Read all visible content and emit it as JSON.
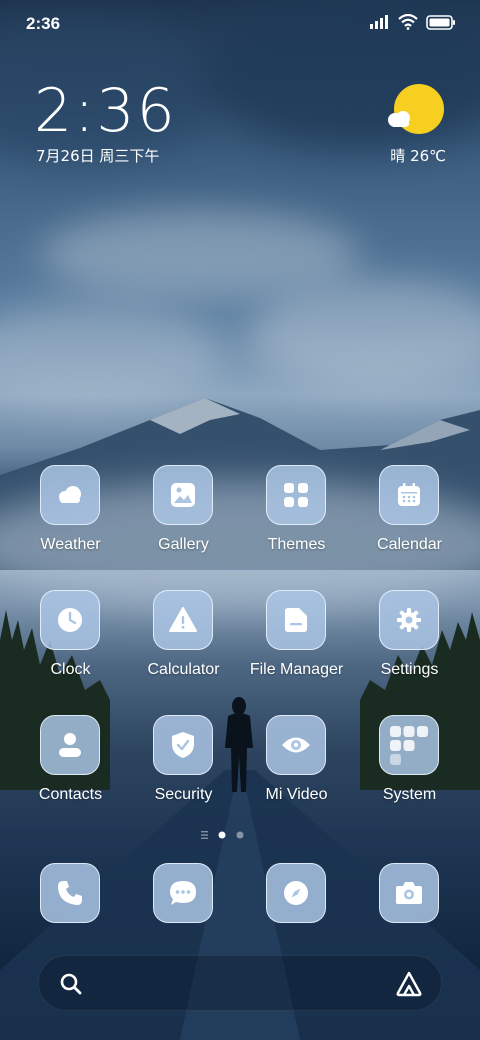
{
  "status_bar": {
    "time": "2:36",
    "signal_icon": "signal-icon",
    "wifi_icon": "wifi-icon",
    "battery_icon": "battery-icon"
  },
  "clock_widget": {
    "time": "2:36",
    "date": "7月26日 周三下午"
  },
  "weather_widget": {
    "condition_icon": "sun-cloud-icon",
    "text": "晴 26℃",
    "sun_color": "#f7cf20"
  },
  "apps": [
    {
      "label": "Weather",
      "icon": "weather-cloud-icon"
    },
    {
      "label": "Gallery",
      "icon": "gallery-icon"
    },
    {
      "label": "Themes",
      "icon": "themes-grid-icon"
    },
    {
      "label": "Calendar",
      "icon": "calendar-icon"
    },
    {
      "label": "Clock",
      "icon": "clock-icon"
    },
    {
      "label": "Calculator",
      "icon": "warning-icon"
    },
    {
      "label": "File Manager",
      "icon": "folder-icon"
    },
    {
      "label": "Settings",
      "icon": "gear-icon"
    },
    {
      "label": "Contacts",
      "icon": "person-icon"
    },
    {
      "label": "Security",
      "icon": "shield-check-icon"
    },
    {
      "label": "Mi Video",
      "icon": "eye-icon"
    },
    {
      "label": "System",
      "icon": "folder-grid-icon"
    }
  ],
  "page_indicator": {
    "pages": 2,
    "current": 1
  },
  "dock": [
    {
      "icon": "phone-icon"
    },
    {
      "icon": "message-icon"
    },
    {
      "icon": "compass-icon"
    },
    {
      "icon": "camera-icon"
    }
  ],
  "search_bar": {
    "search_icon": "search-icon",
    "assistant_icon": "assistant-icon"
  },
  "colors": {
    "tile_bg": "#aac4e4",
    "glyph": "#ffffff",
    "accent_sun": "#f7cf20"
  }
}
